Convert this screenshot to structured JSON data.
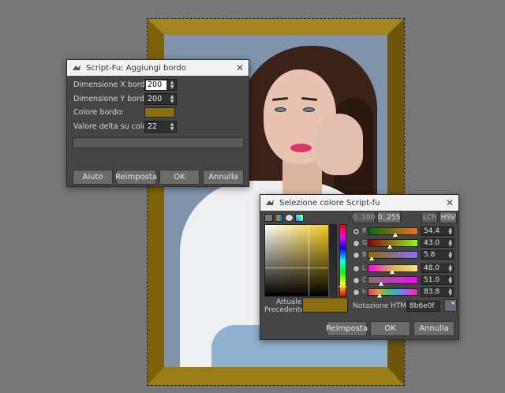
{
  "border_dialog": {
    "title": "Script-Fu: Aggiungi bordo",
    "fields": [
      {
        "label": "Dimensione X bordo:",
        "value": "200"
      },
      {
        "label": "Dimensione Y bordo:",
        "value": "200"
      },
      {
        "label": "Colore bordo:"
      },
      {
        "label": "Valore delta su colore:",
        "value": "22"
      }
    ],
    "border_color": "#8b6e0f",
    "buttons": {
      "help": "Aiuto",
      "reset": "Reimposta",
      "ok": "OK",
      "cancel": "Annulla"
    }
  },
  "color_dialog": {
    "title": "Selezione colore Script-fu",
    "ranges": {
      "r100": "0..100",
      "r255": "0..255"
    },
    "models": {
      "lch": "LCh",
      "hsv": "HSV"
    },
    "channels": [
      {
        "letter": "R",
        "value": "54.4",
        "fraction": 0.544
      },
      {
        "letter": "G",
        "value": "43.0",
        "fraction": 0.43
      },
      {
        "letter": "B",
        "value": "5.8",
        "fraction": 0.058
      },
      {
        "letter": "L",
        "value": "48.0",
        "fraction": 0.48
      },
      {
        "letter": "C",
        "value": "51.0",
        "fraction": 0.255
      },
      {
        "letter": "h",
        "value": "83.8",
        "fraction": 0.233
      }
    ],
    "current_label": "Attuale:",
    "previous_label": "Precedente:",
    "html_label": "Notazione HTML:",
    "html_value": "8b6e0f",
    "current_color": "#8b6e0f",
    "buttons": {
      "reset": "Reimposta",
      "ok": "OK",
      "cancel": "Annulla"
    }
  },
  "icons": {
    "close": "close-icon",
    "app": "gimp-icon",
    "picker": "eyedropper-icon"
  }
}
